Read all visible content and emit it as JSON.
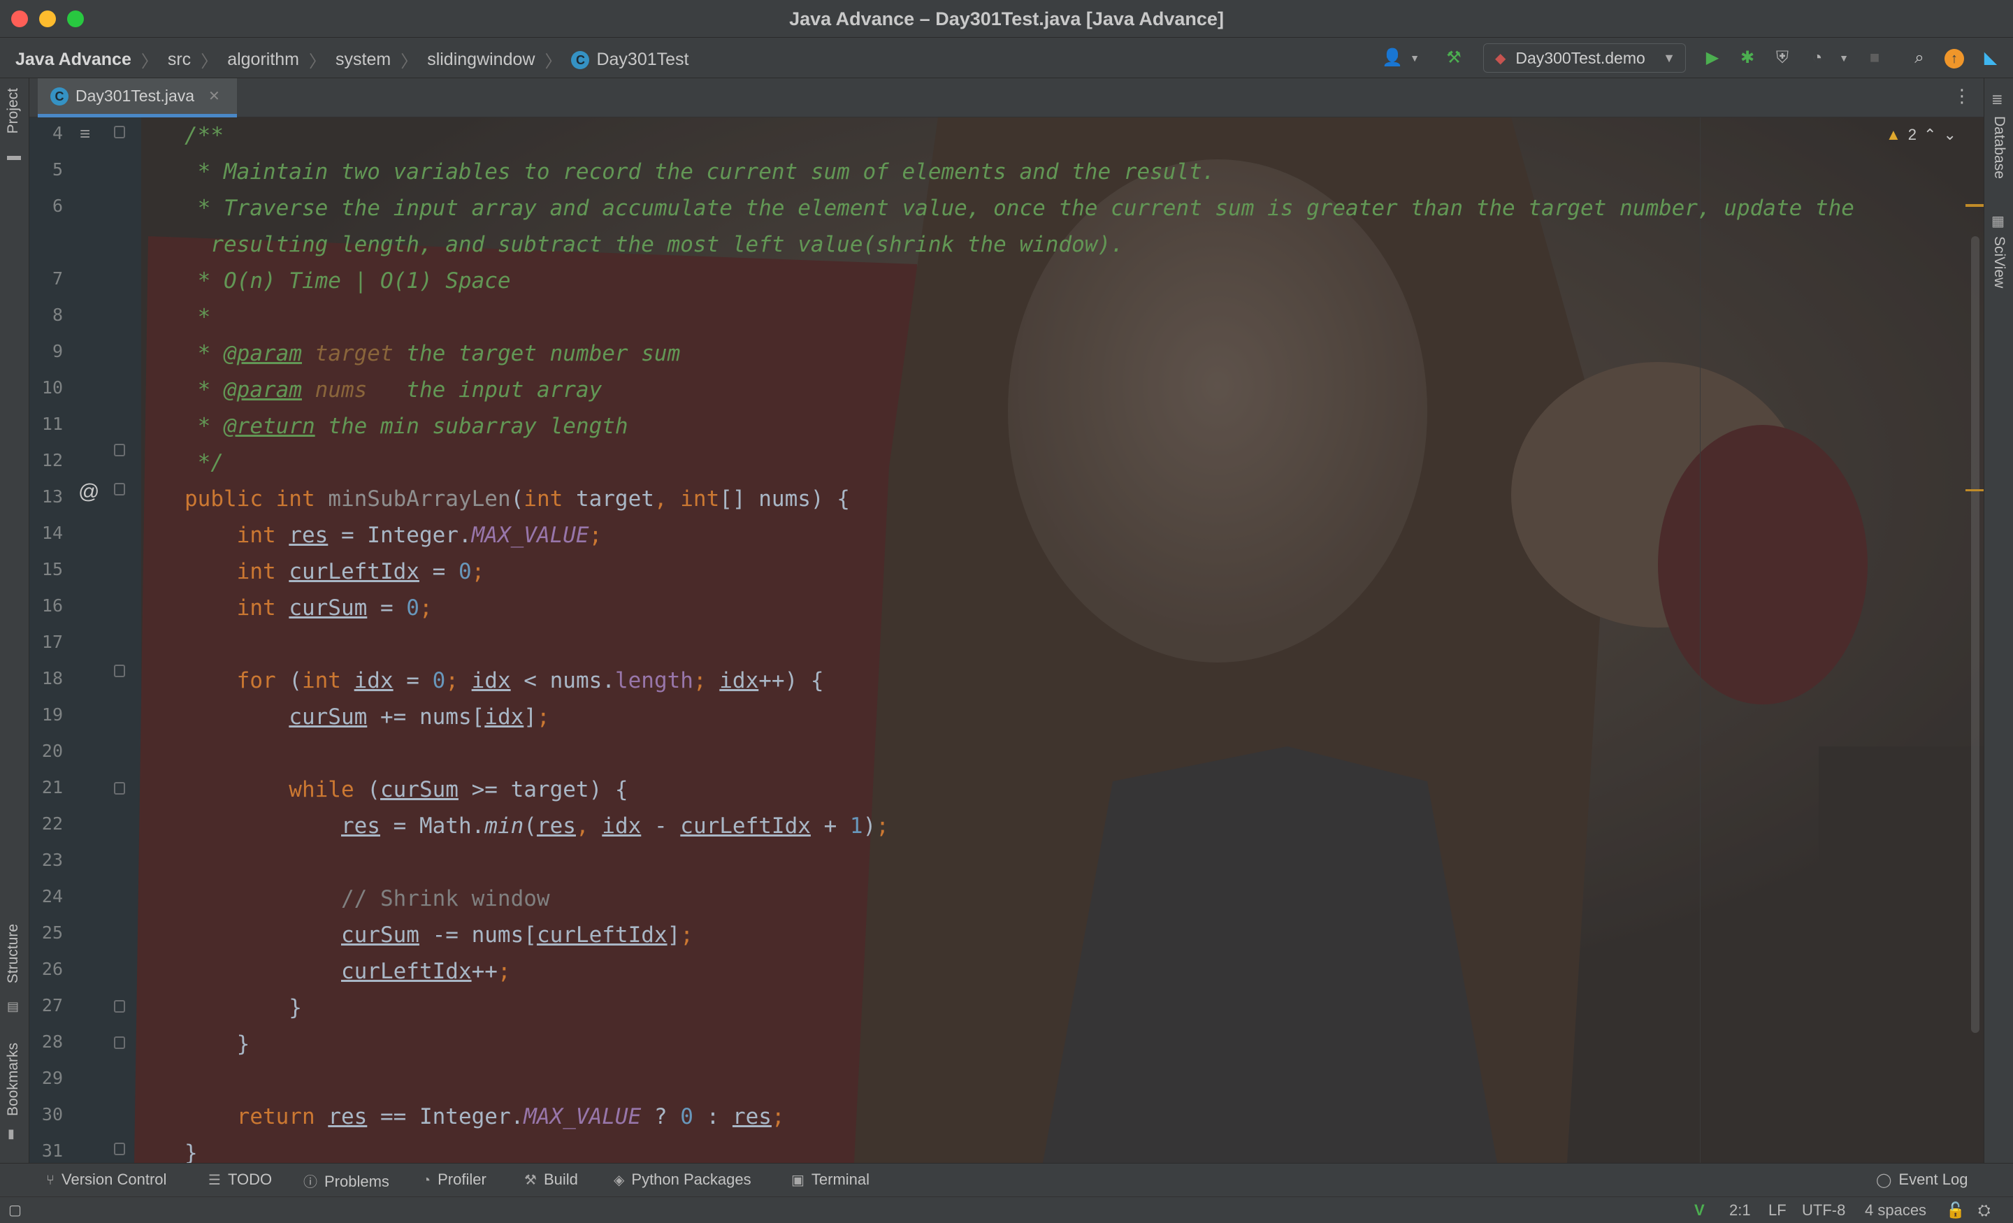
{
  "window": {
    "title": "Java Advance – Day301Test.java [Java Advance]"
  },
  "breadcrumb": [
    "Java Advance",
    "src",
    "algorithm",
    "system",
    "slidingwindow",
    "Day301Test"
  ],
  "breadcrumb_class_icon": "C",
  "run_config": {
    "label": "Day300Test.demo"
  },
  "nav_icons": [
    "user-icon",
    "build-hammer-icon",
    "run-icon",
    "debug-icon",
    "coverage-icon",
    "profile-icon",
    "stop-icon",
    "search-icon",
    "update-icon",
    "jetbrains-logo-icon"
  ],
  "left_strip": {
    "project": "Project",
    "structure": "Structure",
    "bookmarks": "Bookmarks"
  },
  "right_strip": {
    "database": "Database",
    "sciview": "SciView"
  },
  "editor_tab": {
    "name": "Day301Test.java",
    "icon": "C"
  },
  "inspection": {
    "warnings": "2"
  },
  "line_numbers": [
    "4",
    "5",
    "6",
    "",
    "7",
    "8",
    "9",
    "10",
    "11",
    "12",
    "13",
    "14",
    "15",
    "16",
    "17",
    "18",
    "19",
    "20",
    "21",
    "22",
    "23",
    "24",
    "25",
    "26",
    "27",
    "28",
    "29",
    "30",
    "31"
  ],
  "code": [
    [
      [
        "doc",
        "/**"
      ]
    ],
    [
      [
        "doc",
        " * Maintain two variables to record the current sum of elements and the result."
      ]
    ],
    [
      [
        "doc",
        " * Traverse the input array and accumulate the element value, once the current sum is greater than the target number, update the"
      ]
    ],
    [
      [
        "doc",
        "  resulting length, and subtract the most left value(shrink the window)."
      ]
    ],
    [
      [
        "doc",
        " * O(n) Time | O(1) Space"
      ]
    ],
    [
      [
        "doc",
        " *"
      ]
    ],
    [
      [
        "doc",
        " * "
      ],
      [
        "tag",
        "@param"
      ],
      [
        "doc",
        " "
      ],
      [
        "param",
        "target"
      ],
      [
        "doc",
        " the target number sum"
      ]
    ],
    [
      [
        "doc",
        " * "
      ],
      [
        "tag",
        "@param"
      ],
      [
        "doc",
        " "
      ],
      [
        "param",
        "nums"
      ],
      [
        "doc",
        "   the input array"
      ]
    ],
    [
      [
        "doc",
        " * "
      ],
      [
        "tag",
        "@return"
      ],
      [
        "doc",
        " the min subarray length"
      ]
    ],
    [
      [
        "doc",
        " */"
      ]
    ],
    [
      [
        "kw",
        "public int "
      ],
      [
        "fnu",
        "minSubArrayLen"
      ],
      [
        "id",
        "("
      ],
      [
        "kw",
        "int "
      ],
      [
        "id",
        "target"
      ],
      [
        "kw",
        ", int"
      ],
      [
        "id",
        "[] nums) {"
      ]
    ],
    [
      [
        "kw",
        "    int "
      ],
      [
        "var",
        "res"
      ],
      [
        "id",
        " = Integer."
      ],
      [
        "const",
        "MAX_VALUE"
      ],
      [
        "kw",
        ";"
      ]
    ],
    [
      [
        "kw",
        "    int "
      ],
      [
        "var",
        "curLeftIdx"
      ],
      [
        "id",
        " = "
      ],
      [
        "num",
        "0"
      ],
      [
        "kw",
        ";"
      ]
    ],
    [
      [
        "kw",
        "    int "
      ],
      [
        "var",
        "curSum"
      ],
      [
        "id",
        " = "
      ],
      [
        "num",
        "0"
      ],
      [
        "kw",
        ";"
      ]
    ],
    [
      [
        "id",
        ""
      ]
    ],
    [
      [
        "kw",
        "    for "
      ],
      [
        "id",
        "("
      ],
      [
        "kw",
        "int "
      ],
      [
        "var",
        "idx"
      ],
      [
        "id",
        " = "
      ],
      [
        "num",
        "0"
      ],
      [
        "kw",
        "; "
      ],
      [
        "var",
        "idx"
      ],
      [
        "id",
        " < nums."
      ],
      [
        "field",
        "length"
      ],
      [
        "kw",
        "; "
      ],
      [
        "var",
        "idx"
      ],
      [
        "id",
        "++) {"
      ]
    ],
    [
      [
        "id",
        "        "
      ],
      [
        "var",
        "curSum"
      ],
      [
        "id",
        " += nums["
      ],
      [
        "var",
        "idx"
      ],
      [
        "id",
        "]"
      ],
      [
        "kw",
        ";"
      ]
    ],
    [
      [
        "id",
        ""
      ]
    ],
    [
      [
        "kw",
        "        while "
      ],
      [
        "id",
        "("
      ],
      [
        "var",
        "curSum"
      ],
      [
        "id",
        " >= target) {"
      ]
    ],
    [
      [
        "id",
        "            "
      ],
      [
        "var",
        "res"
      ],
      [
        "id",
        " = Math."
      ],
      [
        "static",
        "min"
      ],
      [
        "id",
        "("
      ],
      [
        "var",
        "res"
      ],
      [
        "kw",
        ", "
      ],
      [
        "var",
        "idx"
      ],
      [
        "id",
        " - "
      ],
      [
        "var",
        "curLeftIdx"
      ],
      [
        "id",
        " + "
      ],
      [
        "num",
        "1"
      ],
      [
        "id",
        ")"
      ],
      [
        "kw",
        ";"
      ]
    ],
    [
      [
        "id",
        ""
      ]
    ],
    [
      [
        "com",
        "            // Shrink window"
      ]
    ],
    [
      [
        "id",
        "            "
      ],
      [
        "var",
        "curSum"
      ],
      [
        "id",
        " -= nums["
      ],
      [
        "var",
        "curLeftIdx"
      ],
      [
        "id",
        "]"
      ],
      [
        "kw",
        ";"
      ]
    ],
    [
      [
        "id",
        "            "
      ],
      [
        "var",
        "curLeftIdx"
      ],
      [
        "id",
        "++"
      ],
      [
        "kw",
        ";"
      ]
    ],
    [
      [
        "id",
        "        }"
      ]
    ],
    [
      [
        "id",
        "    }"
      ]
    ],
    [
      [
        "id",
        ""
      ]
    ],
    [
      [
        "kw",
        "    return "
      ],
      [
        "var",
        "res"
      ],
      [
        "id",
        " == Integer."
      ],
      [
        "const",
        "MAX_VALUE"
      ],
      [
        "id",
        " ? "
      ],
      [
        "num",
        "0"
      ],
      [
        "id",
        " : "
      ],
      [
        "var",
        "res"
      ],
      [
        "kw",
        ";"
      ]
    ],
    [
      [
        "id",
        "}"
      ]
    ]
  ],
  "tool_windows": {
    "version_control": "Version Control",
    "todo": "TODO",
    "problems": "Problems",
    "profiler": "Profiler",
    "build": "Build",
    "python_packages": "Python Packages",
    "terminal": "Terminal",
    "event_log": "Event Log"
  },
  "status": {
    "position": "2:1",
    "line_sep": "LF",
    "encoding": "UTF-8",
    "indent": "4 spaces"
  }
}
